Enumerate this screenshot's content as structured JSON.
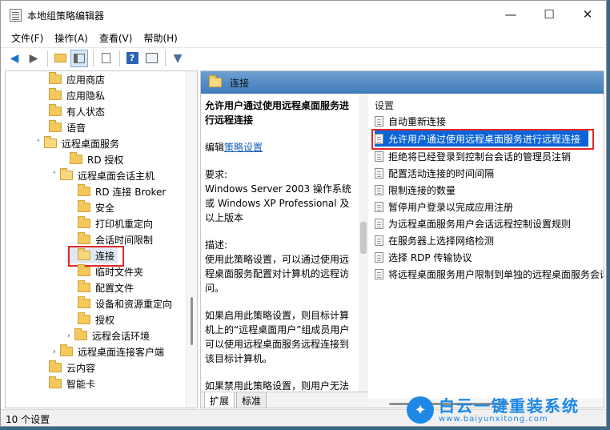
{
  "window": {
    "title": "本地组策略编辑器",
    "minimize_glyph": "—",
    "maximize_glyph": "☐",
    "close_glyph": "✕"
  },
  "menu": [
    "文件(F)",
    "操作(A)",
    "查看(V)",
    "帮助(H)"
  ],
  "tree": {
    "items": [
      {
        "label": "应用商店"
      },
      {
        "label": "应用隐私"
      },
      {
        "label": "有人状态"
      },
      {
        "label": "语音"
      },
      {
        "label": "远程桌面服务"
      },
      {
        "label": "RD 授权"
      },
      {
        "label": "远程桌面会话主机"
      },
      {
        "label": "RD 连接 Broker"
      },
      {
        "label": "安全"
      },
      {
        "label": "打印机重定向"
      },
      {
        "label": "会话时间限制"
      },
      {
        "label": "连接"
      },
      {
        "label": "临时文件夹"
      },
      {
        "label": "配置文件"
      },
      {
        "label": "设备和资源重定向"
      },
      {
        "label": "授权"
      },
      {
        "label": "远程会话环境"
      },
      {
        "label": "远程桌面连接客户端"
      },
      {
        "label": "云内容"
      },
      {
        "label": "智能卡"
      }
    ]
  },
  "detail": {
    "header": "连接",
    "policy_title": "允许用户通过使用远程桌面服务进行远程连接",
    "edit_prefix": "编辑",
    "edit_link": "策略设置",
    "requirements_label": "要求:",
    "requirements": "Windows Server 2003 操作系统或 Windows XP Professional 及以上版本",
    "description_label": "描述:",
    "description": "使用此策略设置，可以通过使用远程桌面服务配置对计算机的远程访问。",
    "enabled_text": "如果启用此策略设置，则目标计算机上的“远程桌面用户”组成员用户可以使用远程桌面服务远程连接到该目标计算机。",
    "disabled_text": "如果禁用此策略设置，则用户无法使用远程桌面服务远程连接到目标计算机。"
  },
  "tabs": [
    "扩展",
    "标准"
  ],
  "settings": {
    "header": "设置",
    "rows": [
      "自动重新连接",
      "允许用户通过使用远程桌面服务进行远程连接",
      "拒绝将已经登录到控制台会话的管理员注销",
      "配置活动连接的时间间隔",
      "限制连接的数量",
      "暂停用户登录以完成应用注册",
      "为远程桌面服务用户会话远程控制设置规则",
      "在服务器上选择网络检测",
      "选择 RDP 传输协议",
      "将远程桌面服务用户限制到单独的远程桌面服务会话"
    ]
  },
  "status": "10 个设置",
  "watermark": {
    "name": "白云一键重装系统",
    "url": "www.baiyunxitong.com"
  }
}
